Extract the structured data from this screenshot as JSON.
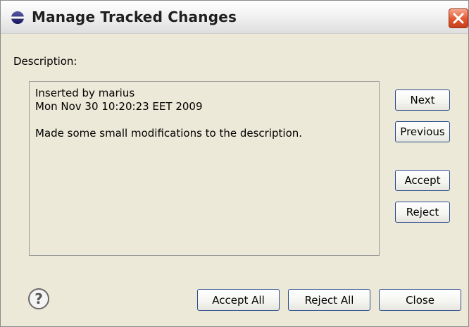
{
  "dialog": {
    "title": "Manage Tracked Changes"
  },
  "content": {
    "description_label": "Description:",
    "change_author": "Inserted by marius",
    "change_date": "Mon Nov 30 10:20:23 EET 2009",
    "change_comment": "Made some small modifications to the description."
  },
  "side_buttons": {
    "next": "Next",
    "previous": "Previous",
    "accept": "Accept",
    "reject": "Reject"
  },
  "footer_buttons": {
    "accept_all": "Accept All",
    "reject_all": "Reject All",
    "close": "Close"
  },
  "icons": {
    "title_icon": "app-icon",
    "close": "close-icon",
    "help": "help-icon"
  },
  "colors": {
    "dialog_bg": "#ece9d8",
    "close_button": "#e0572e",
    "button_border": "#2b4c8c"
  }
}
